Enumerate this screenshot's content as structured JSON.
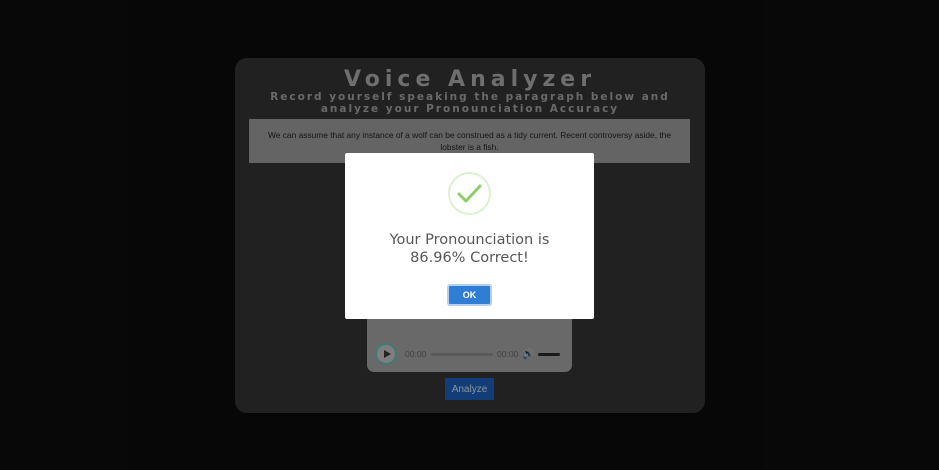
{
  "app": {
    "title": "Voice Analyzer",
    "subtitle": "Record yourself speaking the paragraph below and analyze your Pronounciation Accuracy",
    "paragraph": "We can assume that any instance of a wolf can be construed as a tidy current. Recent controversy aside, the lobster is a fish."
  },
  "audio_player": {
    "current_time": "00:00",
    "duration": "00:00",
    "progress": 0,
    "play_icon": "play-icon",
    "volume_icon": "volume-icon"
  },
  "analyze_button": {
    "label": "Analyze"
  },
  "modal": {
    "icon": "check-icon",
    "message_line1": "Your Pronounciation is",
    "message_line2": "86.96% Correct!",
    "ok_label": "OK"
  },
  "colors": {
    "background": "#0c0c0d",
    "card": "#343434",
    "accent_blue": "#2f7dd4",
    "success_green": "#8ccf6a"
  }
}
